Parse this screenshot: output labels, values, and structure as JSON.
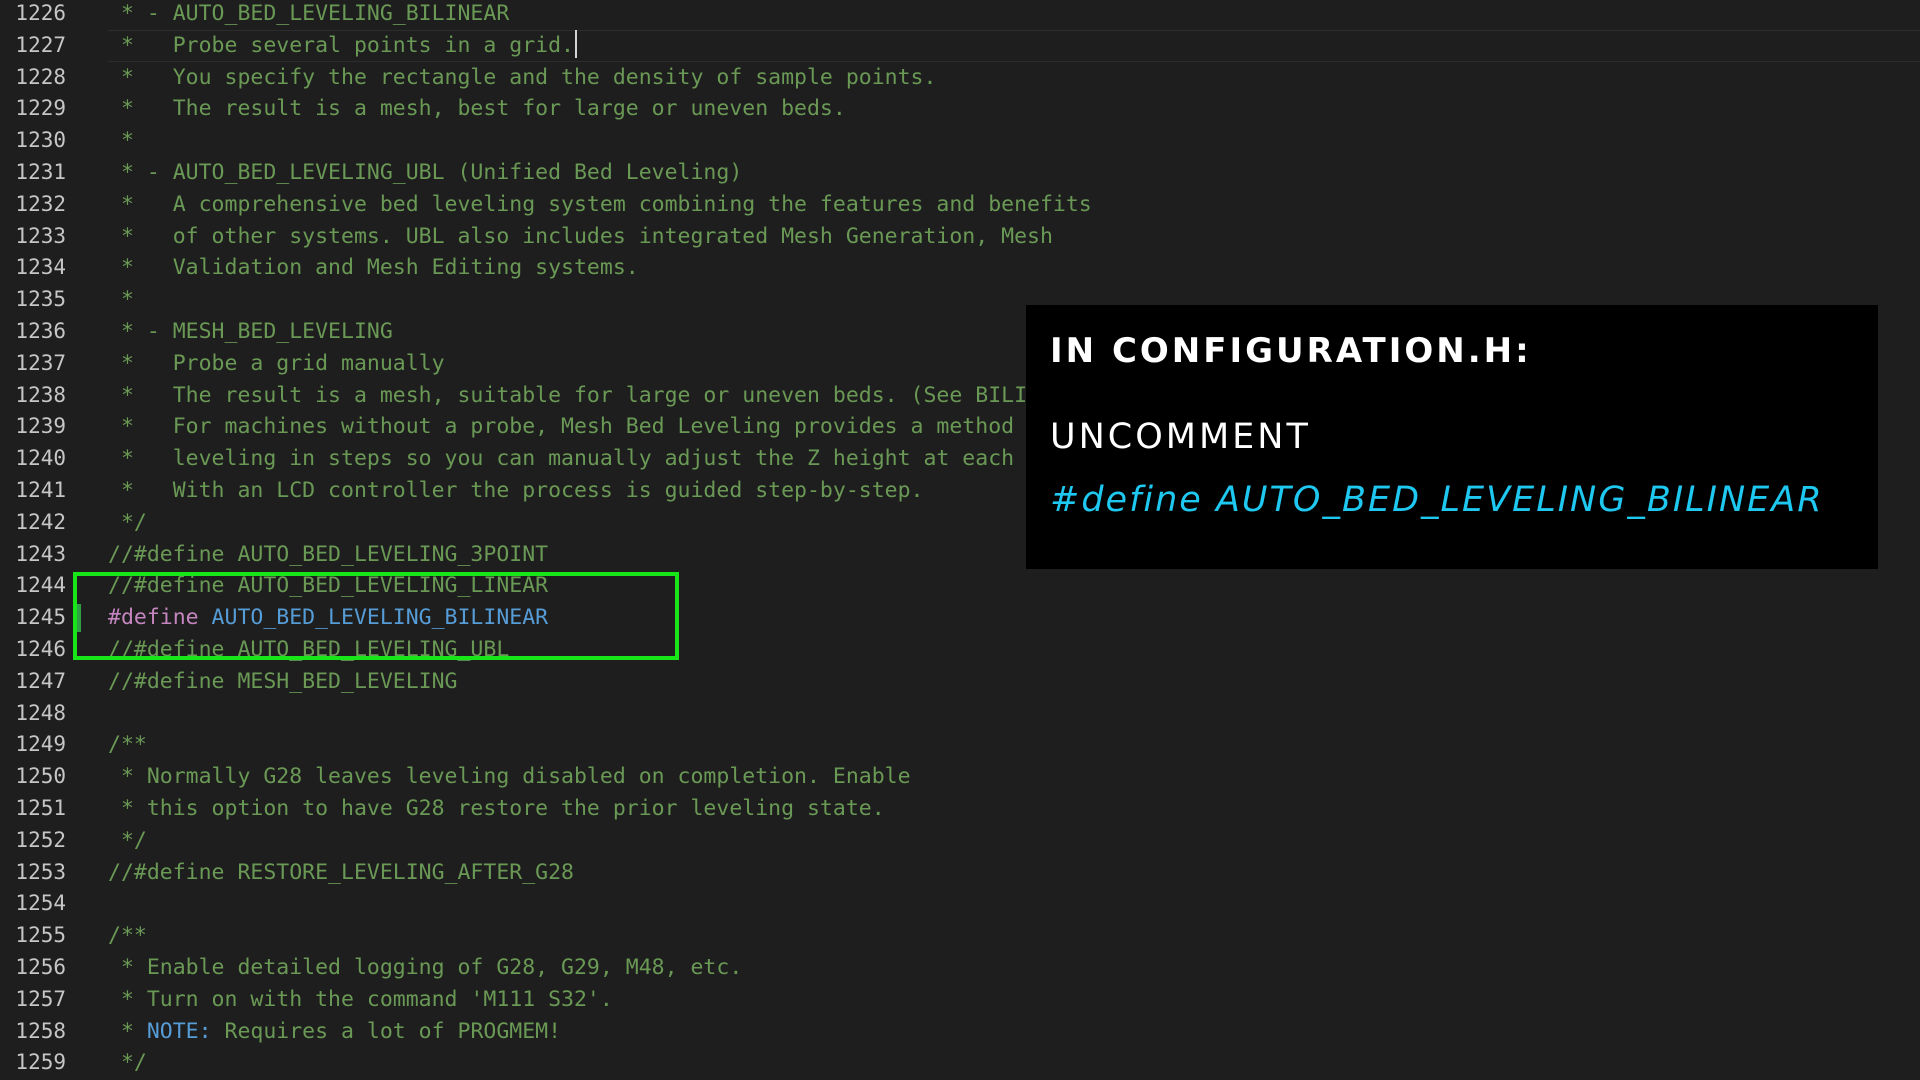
{
  "editor": {
    "lines": [
      {
        "num": "1226",
        "segments": [
          {
            "cls": "plain",
            "text": " * - AUTO_BED_LEVELING_BILINEAR"
          }
        ]
      },
      {
        "num": "1227",
        "segments": [
          {
            "cls": "plain",
            "text": " *   Probe several points in a grid."
          }
        ],
        "cursor": true
      },
      {
        "num": "1228",
        "segments": [
          {
            "cls": "plain",
            "text": " *   You specify the rectangle and the density of sample points."
          }
        ]
      },
      {
        "num": "1229",
        "segments": [
          {
            "cls": "plain",
            "text": " *   The result is a mesh, best for large or uneven beds."
          }
        ]
      },
      {
        "num": "1230",
        "segments": [
          {
            "cls": "plain",
            "text": " *"
          }
        ]
      },
      {
        "num": "1231",
        "segments": [
          {
            "cls": "plain",
            "text": " * - AUTO_BED_LEVELING_UBL (Unified Bed Leveling)"
          }
        ]
      },
      {
        "num": "1232",
        "segments": [
          {
            "cls": "plain",
            "text": " *   A comprehensive bed leveling system combining the features and benefits"
          }
        ]
      },
      {
        "num": "1233",
        "segments": [
          {
            "cls": "plain",
            "text": " *   of other systems. UBL also includes integrated Mesh Generation, Mesh"
          }
        ]
      },
      {
        "num": "1234",
        "segments": [
          {
            "cls": "plain",
            "text": " *   Validation and Mesh Editing systems."
          }
        ]
      },
      {
        "num": "1235",
        "segments": [
          {
            "cls": "plain",
            "text": " *"
          }
        ]
      },
      {
        "num": "1236",
        "segments": [
          {
            "cls": "plain",
            "text": " * - MESH_BED_LEVELING"
          }
        ]
      },
      {
        "num": "1237",
        "segments": [
          {
            "cls": "plain",
            "text": " *   Probe a grid manually"
          }
        ]
      },
      {
        "num": "1238",
        "segments": [
          {
            "cls": "plain",
            "text": " *   The result is a mesh, suitable for large or uneven beds. (See BILINEAR.)"
          }
        ]
      },
      {
        "num": "1239",
        "segments": [
          {
            "cls": "plain",
            "text": " *   For machines without a probe, Mesh Bed Leveling provides a method to"
          }
        ]
      },
      {
        "num": "1240",
        "segments": [
          {
            "cls": "plain",
            "text": " *   leveling in steps so you can manually adjust the Z height at each grid-point."
          }
        ]
      },
      {
        "num": "1241",
        "segments": [
          {
            "cls": "plain",
            "text": " *   With an LCD controller the process is guided step-by-step."
          }
        ]
      },
      {
        "num": "1242",
        "segments": [
          {
            "cls": "plain",
            "text": " */"
          }
        ]
      },
      {
        "num": "1243",
        "segments": [
          {
            "cls": "plain",
            "text": "//#define AUTO_BED_LEVELING_3POINT"
          }
        ]
      },
      {
        "num": "1244",
        "segments": [
          {
            "cls": "plain",
            "text": "//#define AUTO_BED_LEVELING_LINEAR"
          }
        ]
      },
      {
        "num": "1245",
        "segments": [
          {
            "cls": "kw",
            "text": "#define"
          },
          {
            "cls": "mac",
            "text": " AUTO_BED_LEVELING_BILINEAR"
          }
        ],
        "modified": true
      },
      {
        "num": "1246",
        "segments": [
          {
            "cls": "plain",
            "text": "//#define AUTO_BED_LEVELING_UBL"
          }
        ]
      },
      {
        "num": "1247",
        "segments": [
          {
            "cls": "plain",
            "text": "//#define MESH_BED_LEVELING"
          }
        ]
      },
      {
        "num": "1248",
        "segments": [
          {
            "cls": "plain",
            "text": ""
          }
        ]
      },
      {
        "num": "1249",
        "segments": [
          {
            "cls": "plain",
            "text": "/**"
          }
        ]
      },
      {
        "num": "1250",
        "segments": [
          {
            "cls": "plain",
            "text": " * Normally G28 leaves leveling disabled on completion. Enable"
          }
        ]
      },
      {
        "num": "1251",
        "segments": [
          {
            "cls": "plain",
            "text": " * this option to have G28 restore the prior leveling state."
          }
        ]
      },
      {
        "num": "1252",
        "segments": [
          {
            "cls": "plain",
            "text": " */"
          }
        ]
      },
      {
        "num": "1253",
        "segments": [
          {
            "cls": "plain",
            "text": "//#define RESTORE_LEVELING_AFTER_G28"
          }
        ]
      },
      {
        "num": "1254",
        "segments": [
          {
            "cls": "plain",
            "text": ""
          }
        ]
      },
      {
        "num": "1255",
        "segments": [
          {
            "cls": "plain",
            "text": "/**"
          }
        ]
      },
      {
        "num": "1256",
        "segments": [
          {
            "cls": "plain",
            "text": " * Enable detailed logging of G28, G29, M48, etc."
          }
        ]
      },
      {
        "num": "1257",
        "segments": [
          {
            "cls": "plain",
            "text": " * Turn on with the command 'M111 S32'."
          }
        ]
      },
      {
        "num": "1258",
        "segments": [
          {
            "cls": "plain",
            "text": " * "
          },
          {
            "cls": "note",
            "text": "NOTE:"
          },
          {
            "cls": "plain",
            "text": " Requires a lot of PROGMEM!"
          }
        ]
      },
      {
        "num": "1259",
        "segments": [
          {
            "cls": "plain",
            "text": " */"
          }
        ]
      }
    ]
  },
  "overlay": {
    "title": "IN CONFIGURATION.H:",
    "action": "UNCOMMENT",
    "code": "#define AUTO_BED_LEVELING_BILINEAR"
  },
  "colors": {
    "background": "#1e1e1e",
    "comment": "#6a9955",
    "keyword": "#c586c0",
    "macro": "#569cd6",
    "highlight_box": "#19e619",
    "overlay_code": "#1ec8f0"
  }
}
